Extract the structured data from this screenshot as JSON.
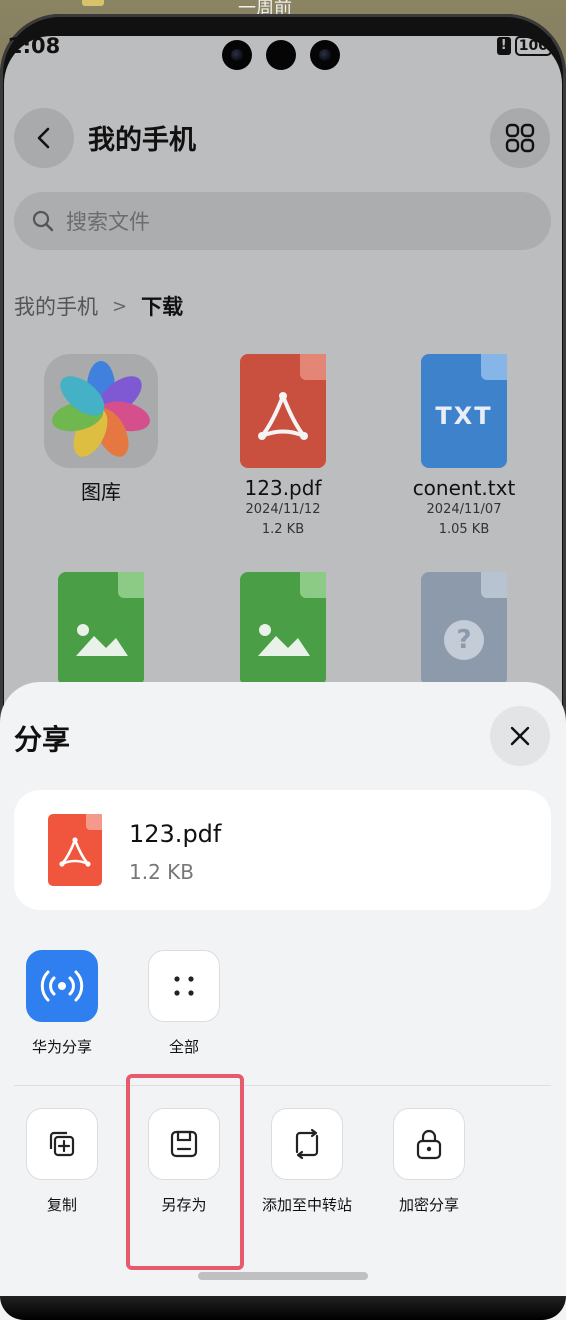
{
  "wallpaper": {
    "top_text": "一周前"
  },
  "status_bar": {
    "time": "2:08",
    "alert": "!",
    "battery": "100"
  },
  "header": {
    "title": "我的手机"
  },
  "search": {
    "placeholder": "搜索文件"
  },
  "breadcrumb": {
    "root": "我的手机",
    "separator": ">",
    "current": "下载"
  },
  "files": [
    {
      "name": "图库",
      "date": "",
      "size": "",
      "icon": "gallery-icon"
    },
    {
      "name": "123.pdf",
      "date": "2024/11/12",
      "size": "1.2 KB",
      "icon": "pdf-icon"
    },
    {
      "name": "conent.txt",
      "date": "2024/11/07",
      "size": "1.05 KB",
      "icon": "txt-icon"
    },
    {
      "name": "",
      "icon": "image-file-icon"
    },
    {
      "name": "",
      "icon": "image-file-icon"
    },
    {
      "name": "",
      "icon": "unknown-file-icon"
    }
  ],
  "txt_badge": "TXT",
  "unknown_badge": "?",
  "sheet": {
    "title": "分享",
    "file": {
      "name": "123.pdf",
      "size": "1.2 KB"
    },
    "share_targets": [
      {
        "label": "华为分享",
        "icon": "huawei-share-icon"
      },
      {
        "label": "全部",
        "icon": "more-dots-icon"
      }
    ],
    "actions": [
      {
        "label": "复制",
        "icon": "copy-icon"
      },
      {
        "label": "另存为",
        "icon": "save-as-icon"
      },
      {
        "label": "添加至中转站",
        "icon": "transfer-station-icon"
      },
      {
        "label": "加密分享",
        "icon": "lock-icon"
      }
    ]
  },
  "colors": {
    "pdf_red": "#e24a38",
    "txt_blue": "#3f8fe0",
    "image_green": "#4db34a",
    "unknown_gray": "#98a8bd",
    "huawei_blue": "#2f7ff0",
    "highlight": "#e75a6b"
  }
}
